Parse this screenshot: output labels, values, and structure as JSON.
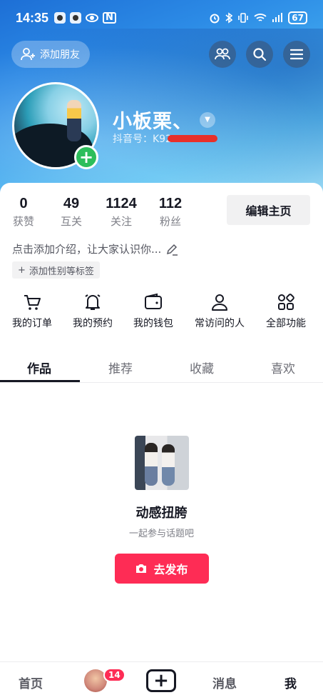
{
  "status_bar": {
    "time": "14:35",
    "battery": "67"
  },
  "header": {
    "add_friend_label": "添加朋友"
  },
  "profile": {
    "username": "小板栗、",
    "douyin_id_label": "抖音号：K92"
  },
  "stats": [
    {
      "value": "0",
      "label": "获赞"
    },
    {
      "value": "49",
      "label": "互关"
    },
    {
      "value": "1124",
      "label": "关注"
    },
    {
      "value": "112",
      "label": "粉丝"
    }
  ],
  "edit_profile_label": "编辑主页",
  "bio_placeholder": "点击添加介绍，让大家认识你...",
  "tag_button_label": "添加性别等标签",
  "features": [
    {
      "label": "我的订单",
      "icon": "cart-icon"
    },
    {
      "label": "我的预约",
      "icon": "bell-icon"
    },
    {
      "label": "我的钱包",
      "icon": "wallet-icon"
    },
    {
      "label": "常访问的人",
      "icon": "person-icon"
    },
    {
      "label": "全部功能",
      "icon": "grid-icon"
    }
  ],
  "tabs": [
    {
      "label": "作品",
      "active": true
    },
    {
      "label": "推荐",
      "active": false
    },
    {
      "label": "收藏",
      "active": false
    },
    {
      "label": "喜欢",
      "active": false
    }
  ],
  "empty_state": {
    "topic_title": "动感扭胯",
    "topic_subtitle": "一起参与话题吧",
    "publish_label": "去发布"
  },
  "bottom_nav": {
    "home": "首页",
    "friends_badge": "14",
    "messages": "消息",
    "me": "我"
  },
  "colors": {
    "accent": "#fe2c55",
    "avatar_plus": "#2dbe5b"
  }
}
